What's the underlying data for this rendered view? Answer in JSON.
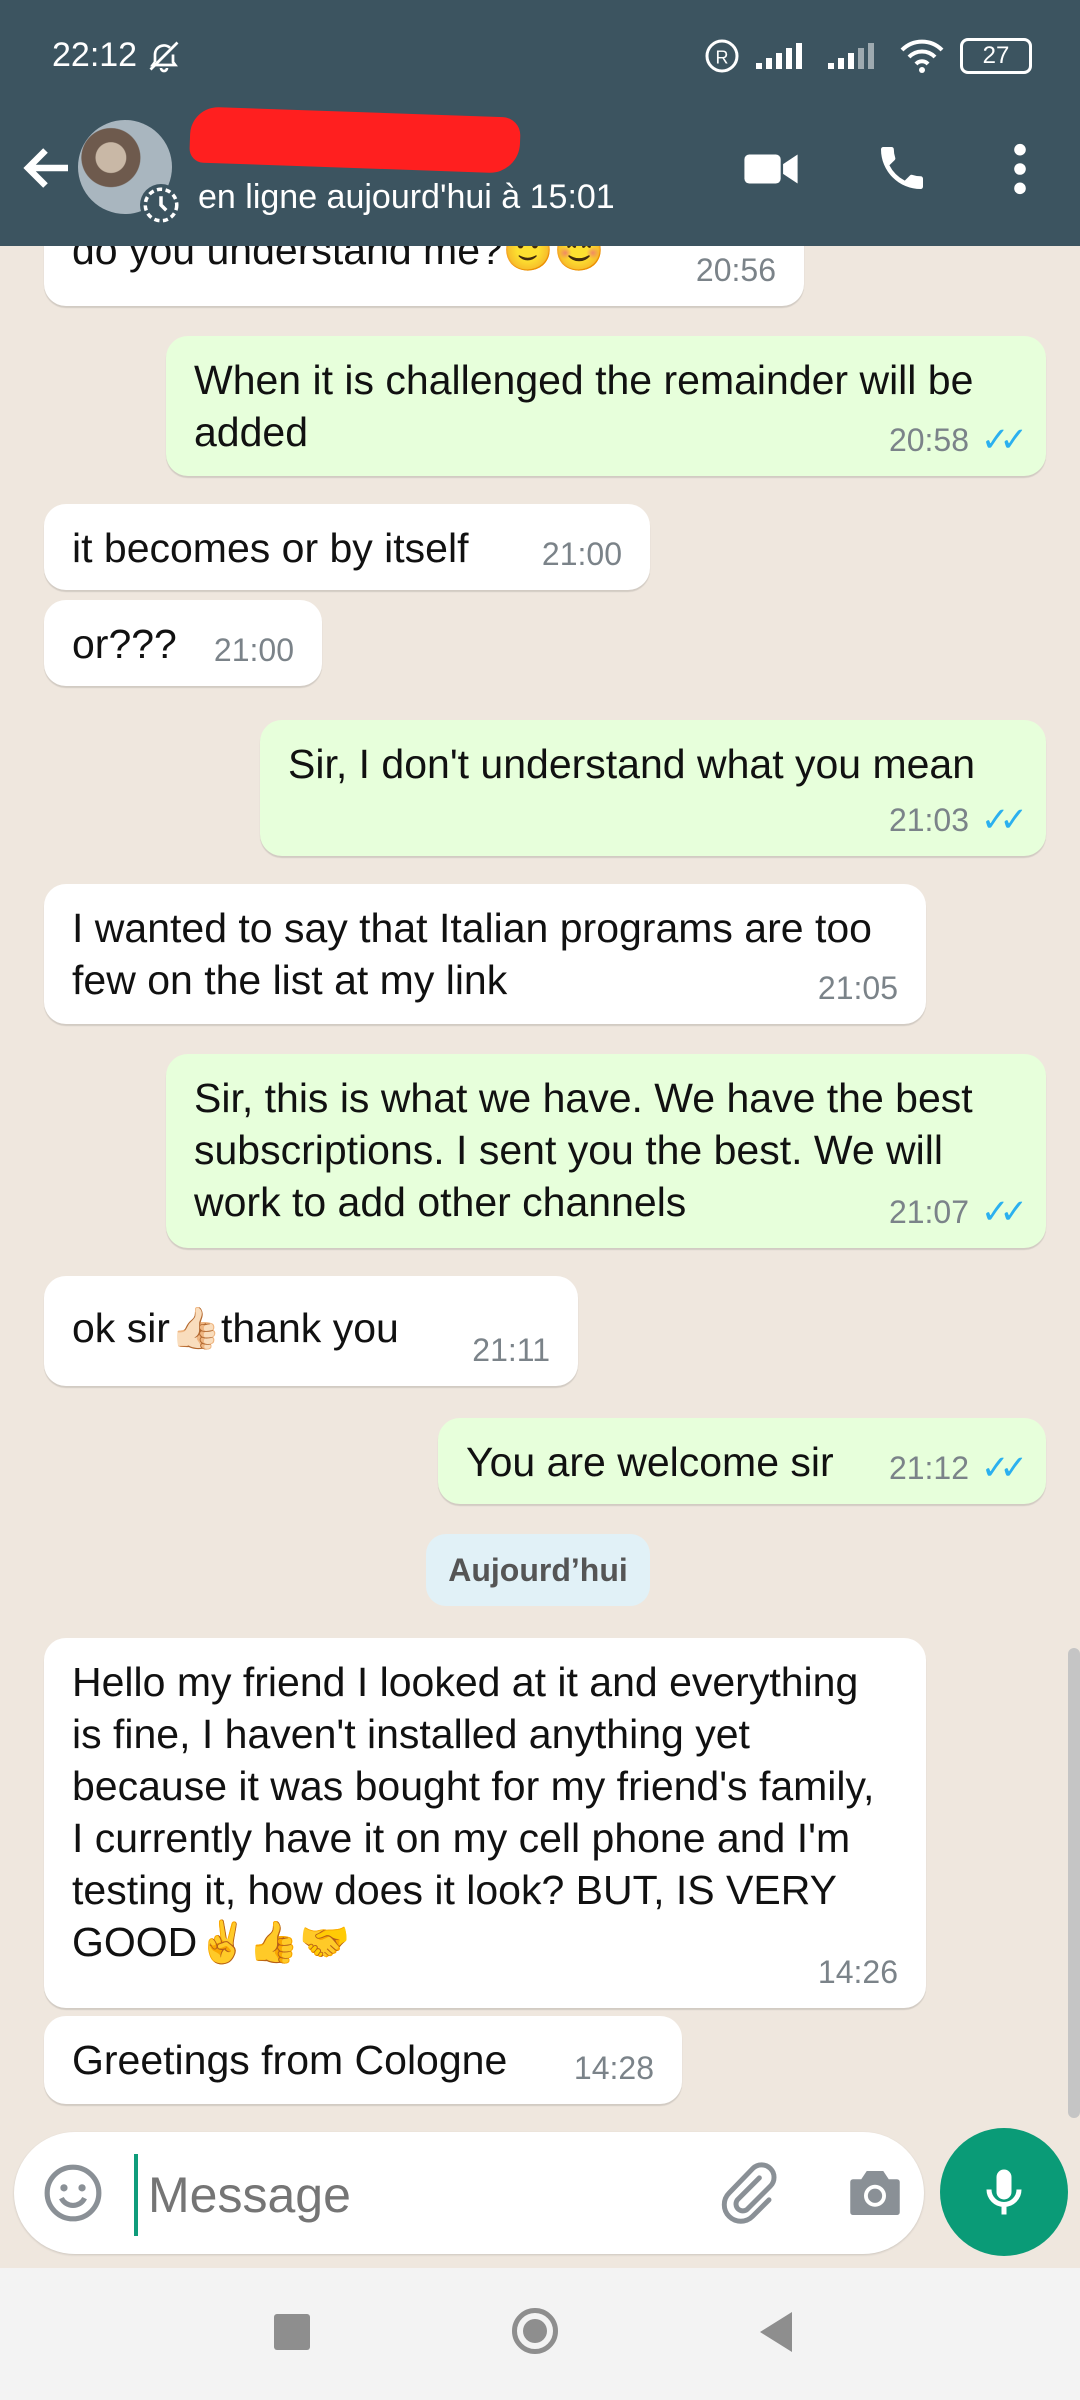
{
  "status": {
    "time": "22:12",
    "battery": "27"
  },
  "header": {
    "subtitle": "en ligne aujourd'hui à 15:01"
  },
  "messages": [
    {
      "dir": "in",
      "text": "do you understand me?🙂😊",
      "time": "20:56"
    },
    {
      "dir": "out",
      "text": "When it is challenged the remainder will be added",
      "time": "20:58"
    },
    {
      "dir": "in",
      "text": "it becomes or by itself",
      "time": "21:00"
    },
    {
      "dir": "in",
      "text": "or???",
      "time": "21:00"
    },
    {
      "dir": "out",
      "text": "Sir, I don't understand what you mean",
      "time": "21:03"
    },
    {
      "dir": "in",
      "text": "I wanted to say that Italian programs are too few on the list at my link",
      "time": "21:05"
    },
    {
      "dir": "out",
      "text": "Sir, this is what we have. We have the best subscriptions. I sent you the best. We will work to add other channels",
      "time": "21:07"
    },
    {
      "dir": "in",
      "text": "ok sir👍🏻thank you",
      "time": "21:11"
    },
    {
      "dir": "out",
      "text": "You are welcome sir",
      "time": "21:12"
    },
    {
      "dir": "in",
      "text": "Hello my friend I looked at it and everything is fine, I haven't installed anything yet because it was bought for my friend's family, I currently have it on my cell phone and I'm testing it, how does it look? BUT, IS VERY GOOD✌️👍🤝",
      "time": "14:26"
    },
    {
      "dir": "in",
      "text": "Greetings from Cologne",
      "time": "14:28"
    }
  ],
  "date_chip": "Aujourd’hui",
  "composer": {
    "placeholder": "Message"
  },
  "icons": {
    "back": "back-arrow-icon",
    "video": "video-call-icon",
    "call": "phone-call-icon",
    "menu": "more-vert-icon",
    "emoji": "emoji-icon",
    "attach": "attach-icon",
    "camera": "camera-icon",
    "mic": "mic-icon"
  },
  "colors": {
    "header": "#3c5460",
    "incoming": "#ffffff",
    "outgoing": "#e7ffdb",
    "accent": "#0a9b77",
    "ticks": "#2bb0ef"
  }
}
